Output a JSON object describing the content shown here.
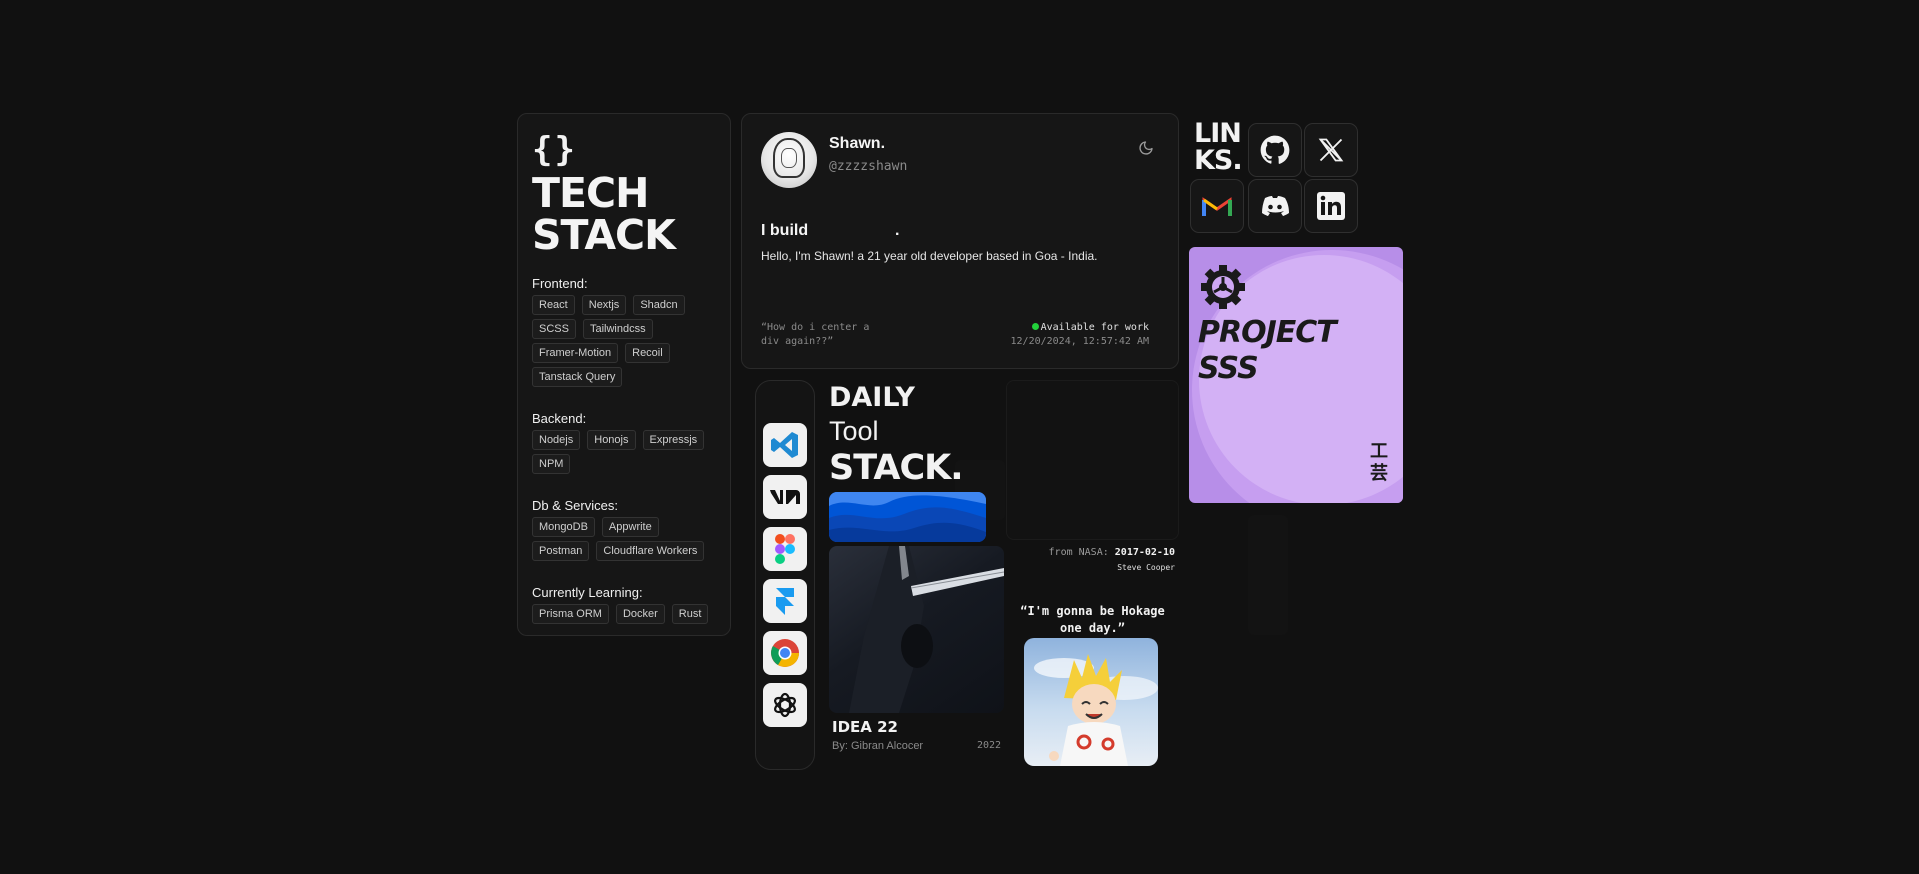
{
  "tech": {
    "brace": "{}",
    "title_line1": "TECH",
    "title_line2": "STACK",
    "sections": [
      {
        "heading": "Frontend:",
        "tags": [
          "React",
          "Nextjs",
          "Shadcn",
          "SCSS",
          "Tailwindcss",
          "Framer-Motion",
          "Recoil",
          "Tanstack Query"
        ]
      },
      {
        "heading": "Backend:",
        "tags": [
          "Nodejs",
          "Honojs",
          "Expressjs",
          "NPM"
        ]
      },
      {
        "heading": "Db & Services:",
        "tags": [
          "MongoDB",
          "Appwrite",
          "Postman",
          "Cloudflare Workers"
        ]
      },
      {
        "heading": "Currently Learning:",
        "tags": [
          "Prisma ORM",
          "Docker",
          "Rust"
        ]
      }
    ]
  },
  "profile": {
    "name": "Shawn.",
    "handle": "@zzzzshawn",
    "build_text": "I build",
    "build_dot": ".",
    "bio": "Hello, I'm Shawn! a 21 year old developer based in Goa - India.",
    "quote": "“How do i center a div again??”",
    "status": "Available for work",
    "timestamp": "12/20/2024, 12:57:42 AM",
    "theme_icon": "moon-icon"
  },
  "links": {
    "title_line1": "LIN",
    "title_line2": "KS.",
    "items": [
      {
        "name": "github-icon"
      },
      {
        "name": "x-icon"
      },
      {
        "name": "gmail-icon"
      },
      {
        "name": "discord-icon"
      },
      {
        "name": "linkedin-icon"
      }
    ]
  },
  "project": {
    "title_line1": "PROJECT",
    "title_line2": "SSS",
    "kanji_1": "工",
    "kanji_2": "芸",
    "color": "#b78ee8"
  },
  "dock": {
    "icons": [
      "vscode-icon",
      "v0-icon",
      "figma-icon",
      "framer-icon",
      "chrome-icon",
      "openai-icon"
    ]
  },
  "daily": {
    "line1": "DAILY",
    "line2": "Tool",
    "line3": "STACK."
  },
  "music": {
    "title": "IDEA 22",
    "artist": "By: Gibran Alcocer",
    "year": "2022"
  },
  "nasa": {
    "prefix": "from NASA:",
    "date": "2017-02-10",
    "credit": "Steve Cooper"
  },
  "anime": {
    "quote": "“I'm gonna be Hokage one day.”"
  }
}
